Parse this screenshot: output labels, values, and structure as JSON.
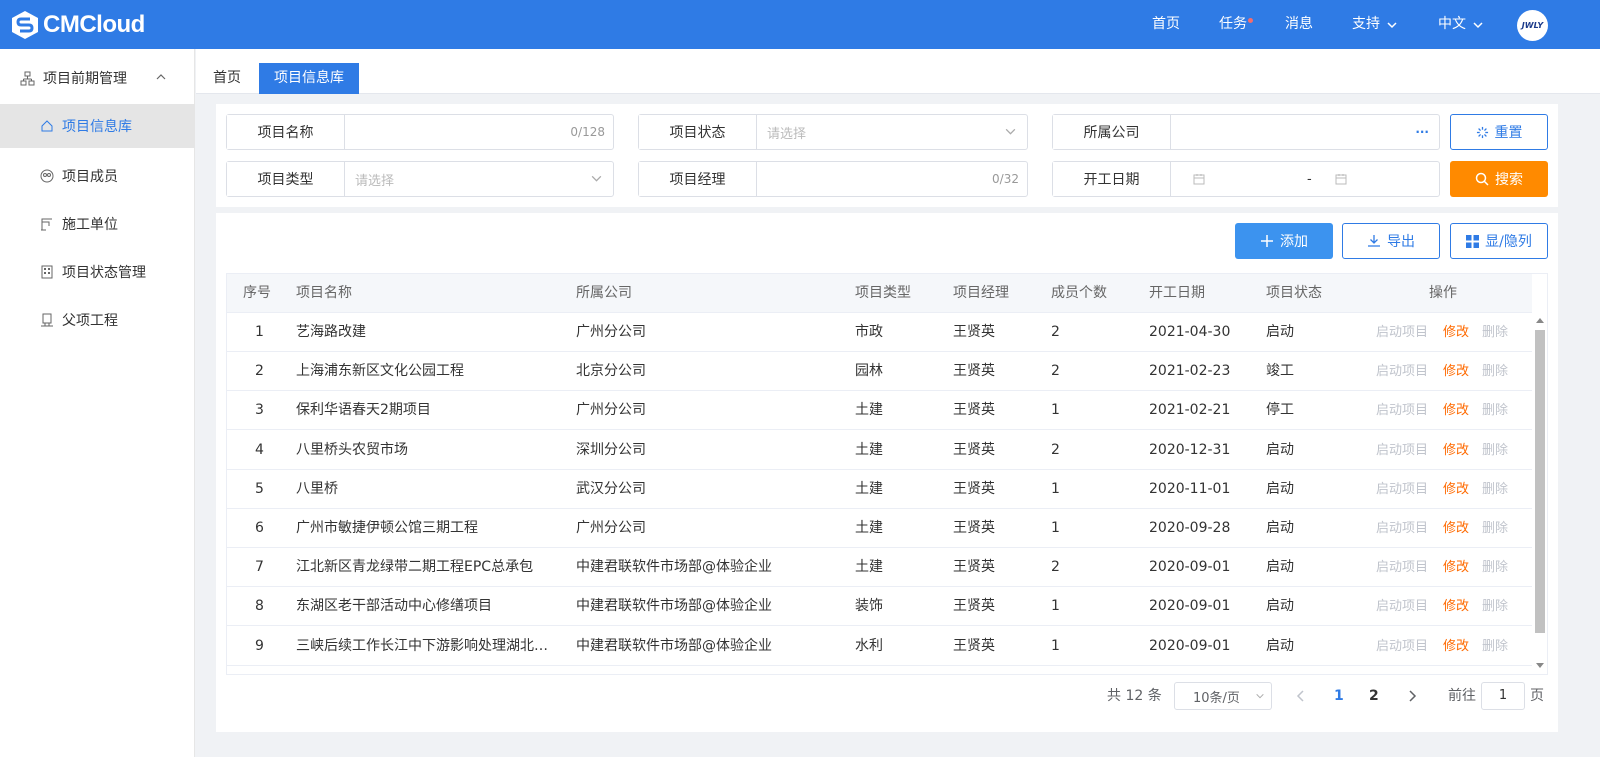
{
  "brand": {
    "name": "CMCloud"
  },
  "topnav": {
    "home": "首页",
    "tasks": "任务",
    "messages": "消息",
    "support": "支持",
    "language": "中文",
    "avatar_text": "JWLY"
  },
  "sidebar": {
    "group": "项目前期管理",
    "items": [
      {
        "label": "项目信息库",
        "icon": "home-icon",
        "active": true
      },
      {
        "label": "项目成员",
        "icon": "members-icon"
      },
      {
        "label": "施工单位",
        "icon": "crane-icon"
      },
      {
        "label": "项目状态管理",
        "icon": "building-icon"
      },
      {
        "label": "父项工程",
        "icon": "project-icon"
      }
    ]
  },
  "tabs": [
    "首页",
    "项目信息库"
  ],
  "filters": {
    "name_label": "项目名称",
    "name_count": "0/128",
    "status_label": "项目状态",
    "status_placeholder": "请选择",
    "company_label": "所属公司",
    "company_more": "···",
    "type_label": "项目类型",
    "type_placeholder": "请选择",
    "manager_label": "项目经理",
    "manager_count": "0/32",
    "date_label": "开工日期",
    "date_sep": "-",
    "reset": "重置",
    "search": "搜索"
  },
  "toolbar": {
    "add": "添加",
    "export": "导出",
    "columns": "显/隐列"
  },
  "table": {
    "headers": [
      "序号",
      "项目名称",
      "所属公司",
      "项目类型",
      "项目经理",
      "成员个数",
      "开工日期",
      "项目状态",
      "操作"
    ],
    "ops": {
      "start": "启动项目",
      "edit": "修改",
      "delete": "删除"
    },
    "rows": [
      [
        "1",
        "艺海路改建",
        "广州分公司",
        "市政",
        "王贤英",
        "2",
        "2021-04-30",
        "启动"
      ],
      [
        "2",
        "上海浦东新区文化公园工程",
        "北京分公司",
        "园林",
        "王贤英",
        "2",
        "2021-02-23",
        "竣工"
      ],
      [
        "3",
        "保利华语春天2期项目",
        "广州分公司",
        "土建",
        "王贤英",
        "1",
        "2021-02-21",
        "停工"
      ],
      [
        "4",
        "八里桥头农贸市场",
        "深圳分公司",
        "土建",
        "王贤英",
        "2",
        "2020-12-31",
        "启动"
      ],
      [
        "5",
        "八里桥",
        "武汉分公司",
        "土建",
        "王贤英",
        "1",
        "2020-11-01",
        "启动"
      ],
      [
        "6",
        "广州市敏捷伊顿公馆三期工程",
        "广州分公司",
        "土建",
        "王贤英",
        "1",
        "2020-09-28",
        "启动"
      ],
      [
        "7",
        "江北新区青龙绿带二期工程EPC总承包",
        "中建君联软件市场部@体验企业",
        "土建",
        "王贤英",
        "2",
        "2020-09-01",
        "启动"
      ],
      [
        "8",
        "东湖区老干部活动中心修缮项目",
        "中建君联软件市场部@体验企业",
        "装饰",
        "王贤英",
        "1",
        "2020-09-01",
        "启动"
      ],
      [
        "9",
        "三峡后续工作长江中下游影响处理湖北荆...",
        "中建君联软件市场部@体验企业",
        "水利",
        "王贤英",
        "1",
        "2020-09-01",
        "启动"
      ]
    ]
  },
  "pagination": {
    "total": "共 12 条",
    "page_size": "10条/页",
    "pages": [
      "1",
      "2"
    ],
    "current": "1",
    "goto_label": "前往",
    "goto_value": "1",
    "page_unit": "页"
  },
  "colors": {
    "primary": "#2f7be5",
    "orange": "#ff8a00",
    "edit": "#ff6a00"
  }
}
